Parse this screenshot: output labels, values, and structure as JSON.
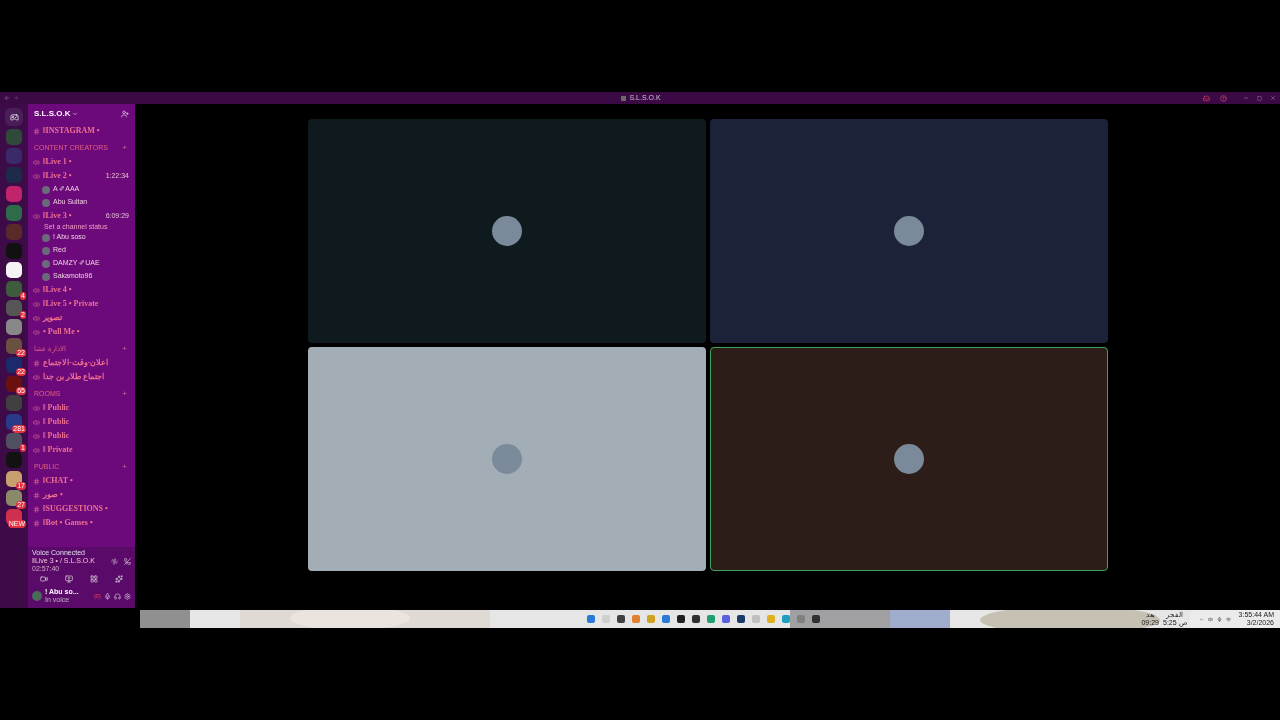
{
  "window": {
    "title": "S.L.S.O.K"
  },
  "server_list": {
    "badges": [
      {
        "color": "#2f4a3a"
      },
      {
        "color": "#3a2a6a"
      },
      {
        "color": "#1e2a4a"
      },
      {
        "color": "#c0246a"
      },
      {
        "color": "#2d6b4a"
      },
      {
        "color": "#5a2a2a"
      },
      {
        "color": "#111111"
      },
      {
        "color": "#f4f4f4"
      },
      {
        "color": "#3c5c3c",
        "badge": "4"
      },
      {
        "color": "#555555",
        "badge": "2"
      },
      {
        "color": "#888888"
      },
      {
        "color": "#6a5040",
        "badge": "22"
      },
      {
        "color": "#1a2a6a",
        "badge": "22"
      },
      {
        "color": "#6a1010",
        "badge": "65"
      },
      {
        "color": "#404040"
      },
      {
        "color": "#2a3a8a",
        "badge": "281"
      },
      {
        "color": "#505060",
        "badge": "1"
      },
      {
        "color": "#121212"
      },
      {
        "color": "#c8a070",
        "badge": "17"
      },
      {
        "color": "#8a8a6a",
        "badge": "27"
      },
      {
        "color": "#d03050",
        "badge": "NEW"
      }
    ]
  },
  "server": {
    "name": "S.L.S.O.K"
  },
  "channels": [
    {
      "kind": "text",
      "name": "ǁINSTAGRAM •"
    },
    {
      "kind": "category",
      "name": "CONTENT CREATORS",
      "add": "+"
    },
    {
      "kind": "voice",
      "name": "ǁLive 1 •"
    },
    {
      "kind": "voice",
      "name": "ǁLive 2 •",
      "time": "1:22:34",
      "users": [
        "A ✐AAA",
        "Abu Sultan"
      ]
    },
    {
      "kind": "voice",
      "name": "ǁLive 3 •",
      "time": "6:09:29",
      "status": "Set a channel status",
      "users": [
        "! Abu soso",
        "Red",
        "DAMZY ✐UAE",
        "Sakamoto96"
      ]
    },
    {
      "kind": "voice",
      "name": "ǁLive 4 •"
    },
    {
      "kind": "voice",
      "name": "ǁLive 5 • Private"
    },
    {
      "kind": "voice",
      "name": "تصوير"
    },
    {
      "kind": "voice",
      "name": "• Pull Me •"
    },
    {
      "kind": "category",
      "name": "الادارة عشا",
      "add": "+"
    },
    {
      "kind": "text",
      "name": "اعلان-وقت-الاجتماع"
    },
    {
      "kind": "voice",
      "name": "اجتماع طلار بن جدا"
    },
    {
      "kind": "category",
      "name": "ROOMS",
      "add": "+"
    },
    {
      "kind": "voice",
      "name": "ǁ Public"
    },
    {
      "kind": "voice",
      "name": "ǁ Public"
    },
    {
      "kind": "voice",
      "name": "ǁ Public"
    },
    {
      "kind": "voice",
      "name": "ǁ Private"
    },
    {
      "kind": "category",
      "name": "PUBLIC",
      "add": "+"
    },
    {
      "kind": "text",
      "name": "ǁCHAT •"
    },
    {
      "kind": "text",
      "name": "صور •"
    },
    {
      "kind": "text",
      "name": "ǁSUGGESTIONS •"
    },
    {
      "kind": "text",
      "name": "ǁBot • Games •"
    }
  ],
  "voice_panel": {
    "status": "Voice Connected",
    "channel": "ǁLive 3 • / S.L.S.O.K",
    "duration": "02:57:40"
  },
  "user_panel": {
    "name": "! Abu so...",
    "status": "In voice"
  },
  "tiles": [
    {
      "color": "#0f1a1e",
      "speaking": false
    },
    {
      "color": "#1c2239",
      "speaking": false
    },
    {
      "color": "#a3adb6",
      "speaking": false
    },
    {
      "color": "#2c1d19",
      "speaking": true
    }
  ],
  "taskbar": {
    "weather_1": "بعد",
    "weather_2": "09:29",
    "prayer_1": "الفجر",
    "prayer_2": "5:25 ص",
    "time": "3:55:44 AM",
    "date": "3/2/2026"
  }
}
